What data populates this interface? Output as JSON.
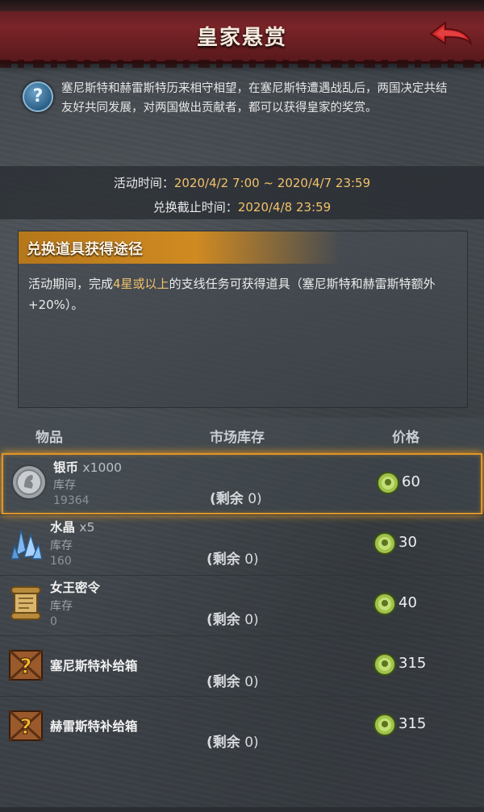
{
  "header": {
    "title": "皇家悬赏",
    "back_icon": "back-arrow-icon"
  },
  "intro": {
    "help_icon": "help-icon",
    "help_glyph": "?",
    "text": "塞尼斯特和赫雷斯特历来相守相望，在塞尼斯特遭遇战乱后，两国决定共结友好共同发展，对两国做出贡献者，都可以获得皇家的奖赏。"
  },
  "activity": {
    "time_label": "活动时间：",
    "time_value": "2020/4/2 7:00 ~ 2020/4/7 23:59",
    "deadline_label": "兑换截止时间：",
    "deadline_value": "2020/4/8 23:59"
  },
  "info": {
    "title": "兑换道具获得途径",
    "text_pre": "活动期间，完成",
    "text_highlight": "4星或以上",
    "text_post": "的支线任务可获得道具（塞尼斯特和赫雷斯特额外+20%）。"
  },
  "table": {
    "col_item": "物品",
    "col_stock": "市场库存",
    "col_price": "价格"
  },
  "items": [
    {
      "name": "银币",
      "qty": "x1000",
      "stock_label": "库存",
      "stock_value": "19364",
      "remain_label": "(剩余",
      "remain_value": "0)",
      "price": "60",
      "icon": "silver-coin-icon"
    },
    {
      "name": "水晶",
      "qty": "x5",
      "stock_label": "库存",
      "stock_value": "160",
      "remain_label": "(剩余",
      "remain_value": "0)",
      "price": "30",
      "icon": "crystal-icon"
    },
    {
      "name": "女王密令",
      "qty": "",
      "stock_label": "库存",
      "stock_value": "0",
      "remain_label": "(剩余",
      "remain_value": "0)",
      "price": "40",
      "icon": "scroll-icon"
    },
    {
      "name": "塞尼斯特补给箱",
      "qty": "",
      "stock_label": "",
      "stock_value": "",
      "remain_label": "(剩余",
      "remain_value": "0)",
      "price": "315",
      "icon": "mystery-crate-icon"
    },
    {
      "name": "赫雷斯特补给箱",
      "qty": "",
      "stock_label": "",
      "stock_value": "",
      "remain_label": "(剩余",
      "remain_value": "0)",
      "price": "315",
      "icon": "mystery-crate-icon"
    }
  ],
  "colors": {
    "accent": "#e0952a",
    "highlight_text": "#f2c16a",
    "title_bar": "#7a2428"
  }
}
